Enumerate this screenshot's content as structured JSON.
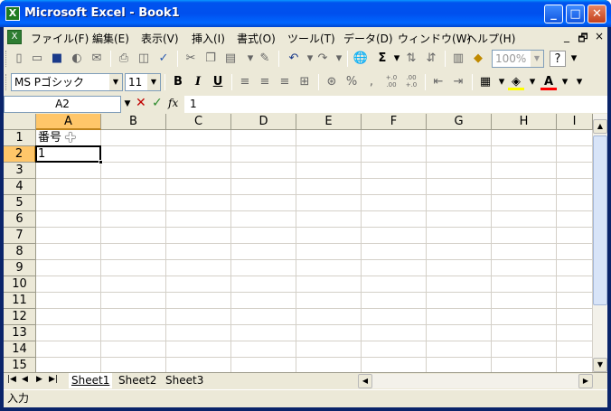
{
  "window": {
    "title": "Microsoft Excel - Book1",
    "app_icon": "excel-icon",
    "buttons": {
      "minimize": "_",
      "maximize": "□",
      "close": "✕"
    }
  },
  "menubar": {
    "items": [
      "ファイル(F)",
      "編集(E)",
      "表示(V)",
      "挿入(I)",
      "書式(O)",
      "ツール(T)",
      "データ(D)",
      "ウィンドウ(W)",
      "ヘルプ(H)"
    ],
    "mdi": {
      "minimize": "_",
      "restore": "🗗",
      "close": "×"
    }
  },
  "standard_toolbar": {
    "zoom": "100%",
    "icons": [
      "new-icon",
      "open-icon",
      "save-icon",
      "permission-icon",
      "email-icon",
      "print-icon",
      "print-preview-icon",
      "spelling-icon",
      "cut-icon",
      "copy-icon",
      "paste-icon",
      "format-painter-icon",
      "undo-icon",
      "redo-icon",
      "hyperlink-icon",
      "autosum-icon",
      "sort-ascending-icon",
      "sort-descending-icon",
      "chart-wizard-icon",
      "drawing-icon",
      "help-icon"
    ],
    "autosum_glyph": "Σ",
    "help_glyph": "?"
  },
  "formatting_toolbar": {
    "font_name": "MS Pゴシック",
    "font_size": "11",
    "bold": "B",
    "italic": "I",
    "underline": "U",
    "percent": "%",
    "comma": ",",
    "inc_decimal": "+.0\n.00",
    "dec_decimal": ".00\n+.0",
    "fill_color": "#ffff00",
    "font_color": "#ff0000",
    "font_color_glyph": "A"
  },
  "formula_bar": {
    "name_box": "A2",
    "cancel": "✕",
    "enter": "✓",
    "fx": "fx",
    "content": "1"
  },
  "sheet": {
    "columns": [
      "A",
      "B",
      "C",
      "D",
      "E",
      "F",
      "G",
      "H",
      "I"
    ],
    "rows": [
      "1",
      "2",
      "3",
      "4",
      "5",
      "6",
      "7",
      "8",
      "9",
      "10",
      "11",
      "12",
      "13",
      "14",
      "15"
    ],
    "active_column": "A",
    "active_row": "2",
    "cells": {
      "A1": "番号",
      "A2": "1"
    }
  },
  "tabs": {
    "nav": [
      "|◀",
      "◀",
      "▶",
      "▶|"
    ],
    "sheets": [
      "Sheet1",
      "Sheet2",
      "Sheet3"
    ],
    "active": "Sheet1"
  },
  "status": {
    "mode": "入力"
  }
}
